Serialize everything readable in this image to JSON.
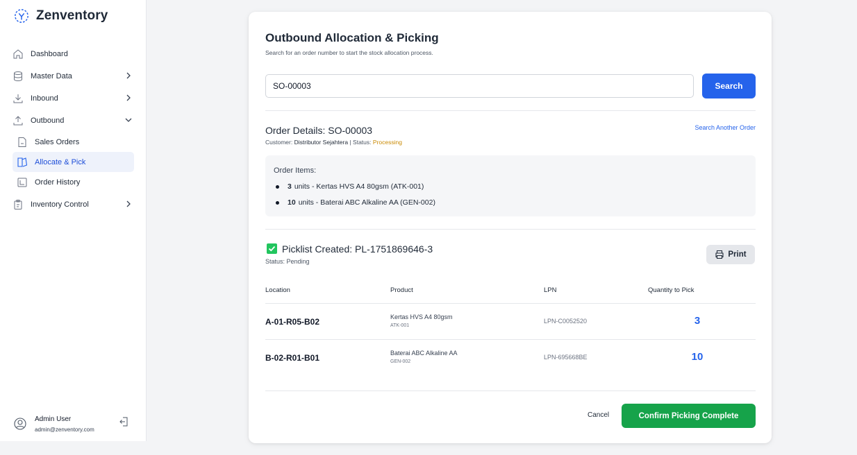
{
  "brand": {
    "name": "Zenventory"
  },
  "sidebar": {
    "items": [
      {
        "label": "Dashboard",
        "icon": "home-icon"
      },
      {
        "label": "Master Data",
        "icon": "database-icon"
      },
      {
        "label": "Inbound",
        "icon": "download-icon"
      },
      {
        "label": "Outbound",
        "icon": "upload-icon"
      }
    ],
    "outbound_sub": [
      {
        "label": "Sales Orders",
        "icon": "document-icon"
      },
      {
        "label": "Allocate & Pick",
        "icon": "allocate-icon"
      },
      {
        "label": "Order History",
        "icon": "history-icon"
      }
    ],
    "inventory": {
      "label": "Inventory Control",
      "icon": "clipboard-icon"
    }
  },
  "user": {
    "name": "Admin User",
    "email": "admin@zenventory.com"
  },
  "page": {
    "title": "Outbound Allocation & Picking",
    "subtitle": "Search for an order number to start the stock allocation process.",
    "search_value": "SO-00003",
    "search_button": "Search"
  },
  "order": {
    "title": "Order Details: SO-00003",
    "customer_label": "Customer:",
    "customer": "Distributor Sejahtera",
    "separator": "|",
    "status_label": "Status:",
    "status": "Processing",
    "search_another": "Search Another Order",
    "items_label": "Order Items:",
    "items": [
      {
        "qty": "3",
        "text": "units - Kertas HVS A4 80gsm (ATK-001)"
      },
      {
        "qty": "10",
        "text": "units - Baterai ABC Alkaline AA (GEN-002)"
      }
    ]
  },
  "picklist": {
    "title": "Picklist Created: PL-1751869646-3",
    "status": "Status: Pending",
    "print": "Print",
    "columns": [
      "Location",
      "Product",
      "LPN",
      "Quantity to Pick"
    ],
    "rows": [
      {
        "location": "A-01-R05-B02",
        "product": "Kertas HVS A4 80gsm",
        "sku": "ATK-001",
        "lpn": "LPN-C0052520",
        "qty": "3"
      },
      {
        "location": "B-02-R01-B01",
        "product": "Baterai ABC Alkaline AA",
        "sku": "GEN-002",
        "lpn": "LPN-695668BE",
        "qty": "10"
      }
    ]
  },
  "actions": {
    "cancel": "Cancel",
    "confirm": "Confirm Picking Complete"
  },
  "colors": {
    "primary": "#2563eb",
    "success": "#16a34a",
    "warning": "#ca8a04",
    "active_bg": "#eef2fb"
  }
}
